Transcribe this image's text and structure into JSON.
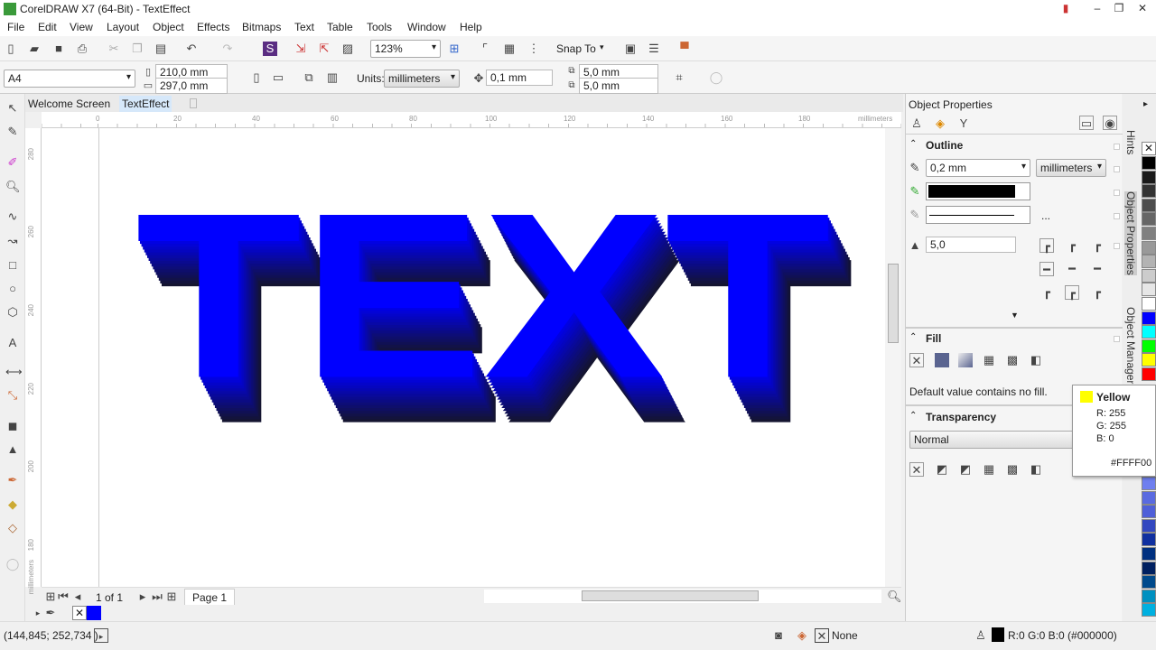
{
  "window": {
    "title": "CorelDRAW X7 (64-Bit) - TextEffect"
  },
  "menu": [
    "File",
    "Edit",
    "View",
    "Layout",
    "Object",
    "Effects",
    "Bitmaps",
    "Text",
    "Table",
    "Tools",
    "Window",
    "Help"
  ],
  "toolbar": {
    "zoom": "123%",
    "snap_to": "Snap To"
  },
  "property_bar": {
    "page_size": "A4",
    "width": "210,0 mm",
    "height": "297,0 mm",
    "units_label": "Units:",
    "units": "millimeters",
    "nudge": "0,1 mm",
    "dup_x": "5,0 mm",
    "dup_y": "5,0 mm"
  },
  "tabs": [
    {
      "label": "Welcome Screen"
    },
    {
      "label": "TextEffect",
      "active": true
    }
  ],
  "rulers": {
    "h": [
      "0",
      "20",
      "40",
      "60",
      "80",
      "100",
      "120",
      "140",
      "160",
      "180"
    ],
    "h_unit": "millimeters",
    "v": [
      "280",
      "260",
      "240",
      "220",
      "200",
      "180"
    ],
    "v_unit": "millimeters"
  },
  "canvas": {
    "artwork_text": "TEXT",
    "fill_color": "#0000FF"
  },
  "page_nav": {
    "count": "1 of 1",
    "page_tab": "Page 1"
  },
  "status": {
    "coords": "(144,845; 252,734 )",
    "fill": "None",
    "outline": "R:0 G:0 B:0 (#000000)"
  },
  "panel": {
    "title": "Object Properties",
    "outline": {
      "title": "Outline",
      "width": "0,2 mm",
      "units": "millimeters",
      "color": "#000000",
      "more": "...",
      "miter": "5,0"
    },
    "fill": {
      "title": "Fill",
      "message": "Default value contains no fill."
    },
    "transparency": {
      "title": "Transparency",
      "mode": "Normal"
    }
  },
  "side_tabs": [
    "Hints",
    "Object Properties",
    "Object Manager"
  ],
  "palette": [
    "#000000",
    "#1a1a1a",
    "#333333",
    "#4d4d4d",
    "#666666",
    "#808080",
    "#999999",
    "#b3b3b3",
    "#cccccc",
    "#e6e6e6",
    "#ffffff",
    "#0000ff",
    "#00ffff",
    "#00ff00",
    "#ffff00",
    "#ff0000"
  ],
  "palette_lower": [
    "#6f7fef",
    "#5a6ae0",
    "#4f5fd8",
    "#3348c0",
    "#1030a0",
    "#003080",
    "#002060",
    "#004a8c",
    "#0090c0",
    "#00b0e0"
  ],
  "tooltip": {
    "name": "Yellow",
    "r": "R: 255",
    "g": "G: 255",
    "b": "B: 0",
    "hex": "#FFFF00",
    "color": "#FFFF00"
  }
}
